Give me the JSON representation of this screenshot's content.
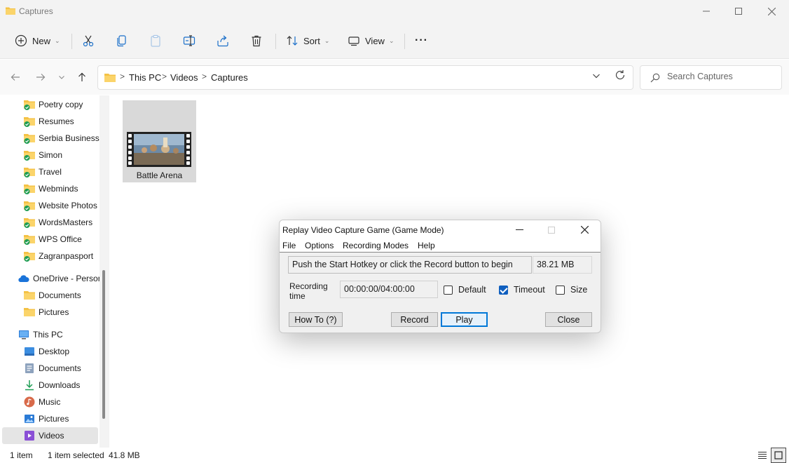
{
  "window": {
    "title": "Captures"
  },
  "toolbar": {
    "new_label": "New",
    "sort_label": "Sort",
    "view_label": "View",
    "more_label": "···"
  },
  "address": {
    "crumbs": [
      "This PC",
      "Videos",
      "Captures"
    ],
    "separator": ">",
    "search_placeholder": "Search Captures"
  },
  "sidebar": {
    "items": [
      {
        "label": "Poetry copy",
        "icon": "folder-synced-icon"
      },
      {
        "label": "Resumes",
        "icon": "folder-synced-icon"
      },
      {
        "label": "Serbia Business",
        "icon": "folder-synced-icon"
      },
      {
        "label": "Simon",
        "icon": "folder-synced-icon"
      },
      {
        "label": "Travel",
        "icon": "folder-synced-icon"
      },
      {
        "label": "Webminds",
        "icon": "folder-synced-icon"
      },
      {
        "label": "Website Photos",
        "icon": "folder-synced-icon"
      },
      {
        "label": "WordsMasters",
        "icon": "folder-synced-icon"
      },
      {
        "label": "WPS Office",
        "icon": "folder-synced-icon"
      },
      {
        "label": "Zagranpasport",
        "icon": "folder-synced-icon"
      },
      {
        "label": "OneDrive - Persor",
        "icon": "onedrive-icon"
      },
      {
        "label": "Documents",
        "icon": "folder-icon"
      },
      {
        "label": "Pictures",
        "icon": "folder-icon"
      },
      {
        "label": "This PC",
        "icon": "monitor-icon"
      },
      {
        "label": "Desktop",
        "icon": "desktop-icon"
      },
      {
        "label": "Documents",
        "icon": "documents-icon"
      },
      {
        "label": "Downloads",
        "icon": "downloads-icon"
      },
      {
        "label": "Music",
        "icon": "music-icon"
      },
      {
        "label": "Pictures",
        "icon": "pictures-icon"
      },
      {
        "label": "Videos",
        "icon": "videos-icon"
      }
    ]
  },
  "files": [
    {
      "name": "Battle Arena",
      "type": "video"
    }
  ],
  "status": {
    "count": "1 item",
    "selection": "1 item selected",
    "size": "41.8 MB"
  },
  "dialog": {
    "title": "Replay Video Capture Game (Game Mode)",
    "menu": [
      "File",
      "Options",
      "Recording Modes",
      "Help"
    ],
    "message": "Push the Start Hotkey or click the Record button to begin",
    "filesize": "38.21 MB",
    "recording_label_1": "Recording",
    "recording_label_2": "time",
    "recording_time": "00:00:00/04:00:00",
    "checkboxes": [
      {
        "label": "Default",
        "checked": false
      },
      {
        "label": "Timeout",
        "checked": true
      },
      {
        "label": "Size",
        "checked": false
      }
    ],
    "buttons": {
      "howto": "How To (?)",
      "record": "Record",
      "play": "Play",
      "close": "Close"
    }
  },
  "colors": {
    "accent": "#0078d7",
    "folder": "#f4c245",
    "sync_check": "#1f9d55",
    "selected_bg": "#e5e5e5"
  }
}
